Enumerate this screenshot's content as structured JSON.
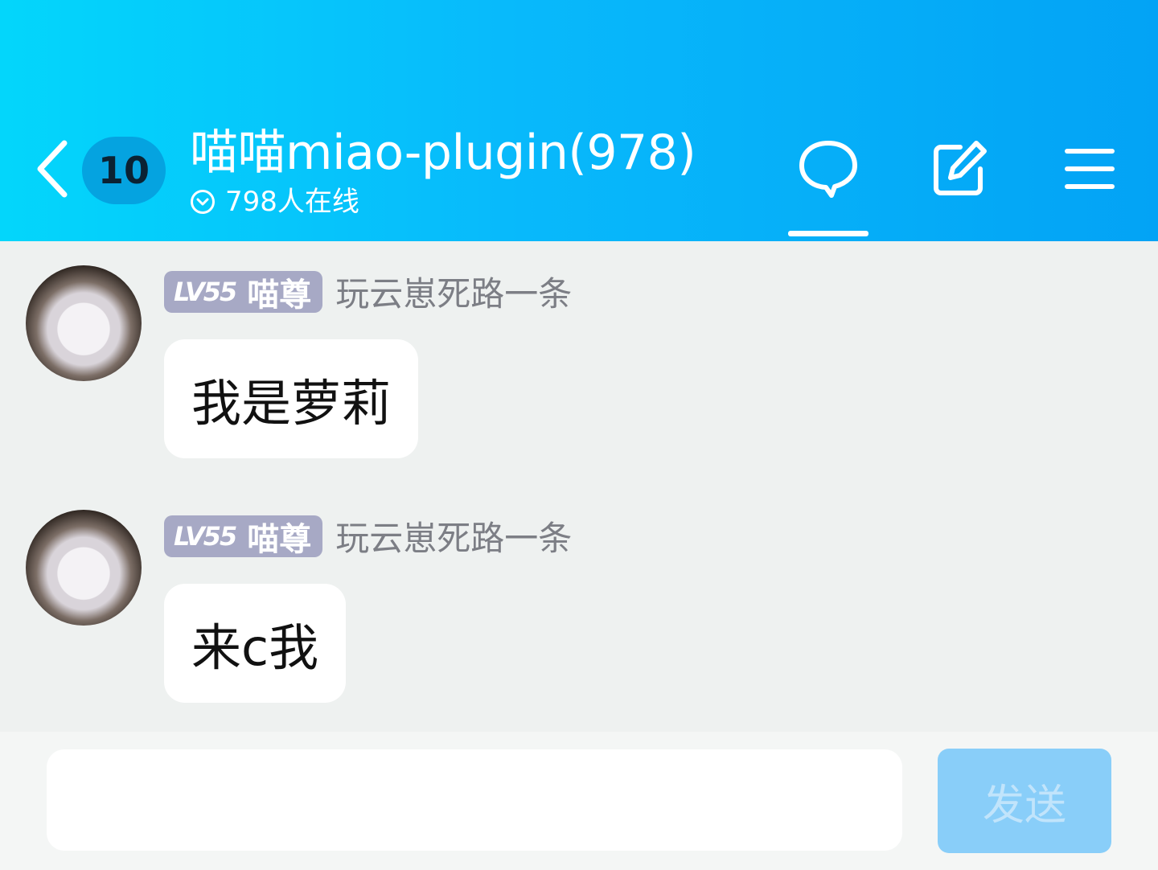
{
  "header": {
    "unread_count": "10",
    "title": "喵喵miao-plugin(978)",
    "online": "798人在线",
    "icons": {
      "back": "chevron-left-icon",
      "online": "chevron-down-circle-icon",
      "chat": "chat-bubble-icon",
      "edit": "edit-icon",
      "menu": "menu-icon"
    }
  },
  "messages": [
    {
      "level": "LV55",
      "rank": "喵尊",
      "nickname": "玩云崽死路一条",
      "text": "我是萝莉"
    },
    {
      "level": "LV55",
      "rank": "喵尊",
      "nickname": "玩云崽死路一条",
      "text": "来c我"
    }
  ],
  "input": {
    "placeholder": ""
  },
  "send_label": "发送",
  "colors": {
    "header_gradient_start": "#03d6fb",
    "header_gradient_end": "#03a3f5",
    "level_badge": "#a7a9c5",
    "send_button": "#89cef9",
    "background": "#eef1f0"
  }
}
